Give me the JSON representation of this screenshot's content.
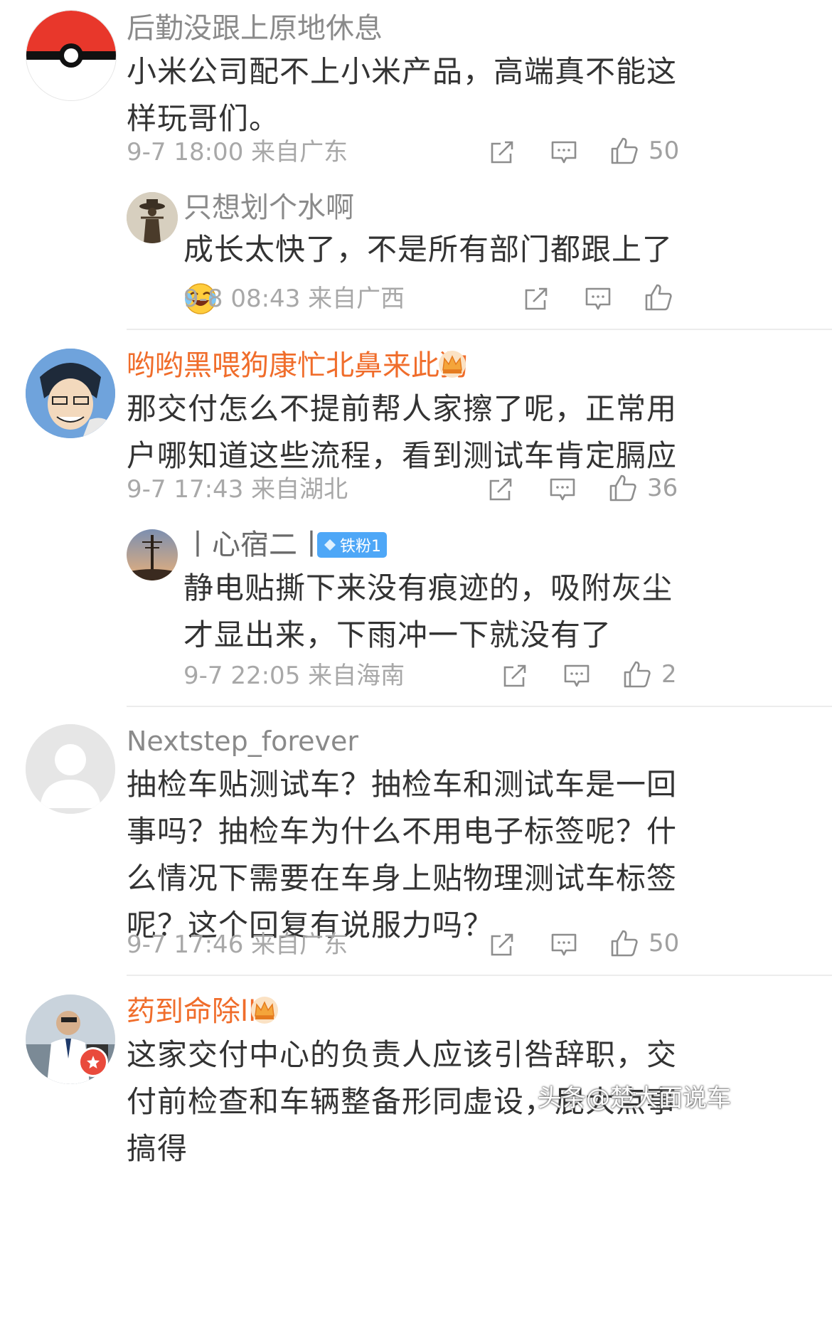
{
  "comments": [
    {
      "username": "后勤没跟上原地休息",
      "text": "小米公司配不上小米产品，高端真不能这样玩哥们。",
      "meta": "9-7 18:00  来自广东",
      "likes": "50",
      "avatar_icon": "pokeball-avatar",
      "reply": {
        "username": "只想划个水啊",
        "text": "成长太快了，不是所有部门都跟上了",
        "emoji": "laughing-crying-emoji",
        "meta": "9-8 08:43  来自广西",
        "likes": ""
      }
    },
    {
      "username": "哟哟黑喂狗康忙北鼻来此狗",
      "username_color": "#f06d2b",
      "vip_icon": "crown-icon",
      "text": "那交付怎么不提前帮人家擦了呢，正常用户哪知道这些流程，看到测试车肯定膈应",
      "meta": "9-7 17:43  来自湖北",
      "likes": "36",
      "reply": {
        "username": "丨心宿二丨",
        "badge": "铁粉1",
        "text": "静电贴撕下来没有痕迹的，吸附灰尘才显出来，下雨冲一下就没有了",
        "meta": "9-7 22:05  来自海南",
        "likes": "2"
      }
    },
    {
      "username": "Nextstep_forever",
      "text": "抽检车贴测试车？抽检车和测试车是一回事吗？抽检车为什么不用电子标签呢？什么情况下需要在车身上贴物理测试车标签呢？这个回复有说服力吗？",
      "meta": "9-7 17:46  来自广东",
      "likes": "50"
    },
    {
      "username": "药到命除ll",
      "username_color": "#f06d2b",
      "vip_icon": "crown-icon",
      "text": "这家交付中心的负责人应该引咎辞职，交付前检查和车辆整备形同虚设，屁大点事搞得",
      "meta": "",
      "likes": ""
    }
  ],
  "watermark": "头条@楚大面说车",
  "colors": {
    "accent_orange": "#f06d2b",
    "meta_gray": "#a8a8a8",
    "badge_blue": "#4ea7f7"
  }
}
